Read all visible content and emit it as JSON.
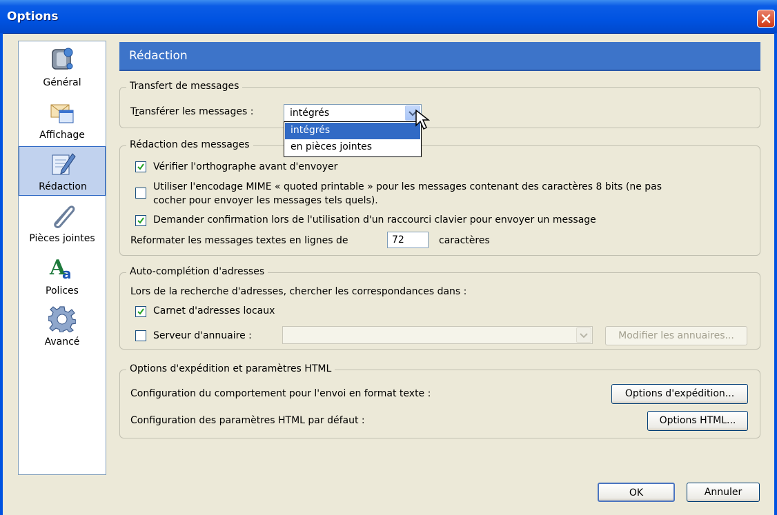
{
  "window": {
    "title": "Options"
  },
  "sidebar": {
    "items": [
      {
        "label": "Général",
        "icon": "general-icon"
      },
      {
        "label": "Affichage",
        "icon": "display-icon"
      },
      {
        "label": "Rédaction",
        "icon": "composition-icon",
        "selected": true
      },
      {
        "label": "Pièces jointes",
        "icon": "paperclip-icon"
      },
      {
        "label": "Polices",
        "icon": "fonts-icon"
      },
      {
        "label": "Avancé",
        "icon": "gear-icon"
      }
    ]
  },
  "header": {
    "title": "Rédaction"
  },
  "forward": {
    "legend": "Transfert de messages",
    "label_pre": "T",
    "label_key": "r",
    "label_post": "ansférer les messages :",
    "value": "intégrés",
    "options": [
      "intégrés",
      "en pièces jointes"
    ]
  },
  "compose": {
    "legend": "Rédaction des messages",
    "spellcheck": {
      "label": "Vérifier l'orthographe avant d'envoyer",
      "checked": true
    },
    "mime_line1": "Utiliser l'encodage MIME « quoted printable » pour les messages contenant des caractères 8 bits (ne pas",
    "mime_line2": "cocher pour envoyer les messages tels quels).",
    "mime_checked": false,
    "confirm": {
      "label": "Demander confirmation lors de l'utilisation d'un raccourci clavier pour envoyer un message",
      "checked": true
    },
    "wrap_label": "Reformater les messages textes en lignes de",
    "wrap_value": "72",
    "wrap_unit": "caractères"
  },
  "autocomplete": {
    "legend": "Auto-complétion d'adresses",
    "desc": "Lors de la recherche d'adresses, chercher les correspondances dans :",
    "local": {
      "label": "Carnet d'adresses locaux",
      "checked": true
    },
    "server": {
      "label": "Serveur d'annuaire :",
      "checked": false
    },
    "edit_button": "Modifier les annuaires..."
  },
  "sending": {
    "legend": "Options d'expédition et paramètres HTML",
    "text_label": "Configuration du comportement pour l'envoi en format texte :",
    "text_button": "Options d'expédition...",
    "html_label": "Configuration des paramètres HTML par défaut :",
    "html_button": "Options HTML..."
  },
  "footer": {
    "ok": "OK",
    "cancel": "Annuler"
  }
}
